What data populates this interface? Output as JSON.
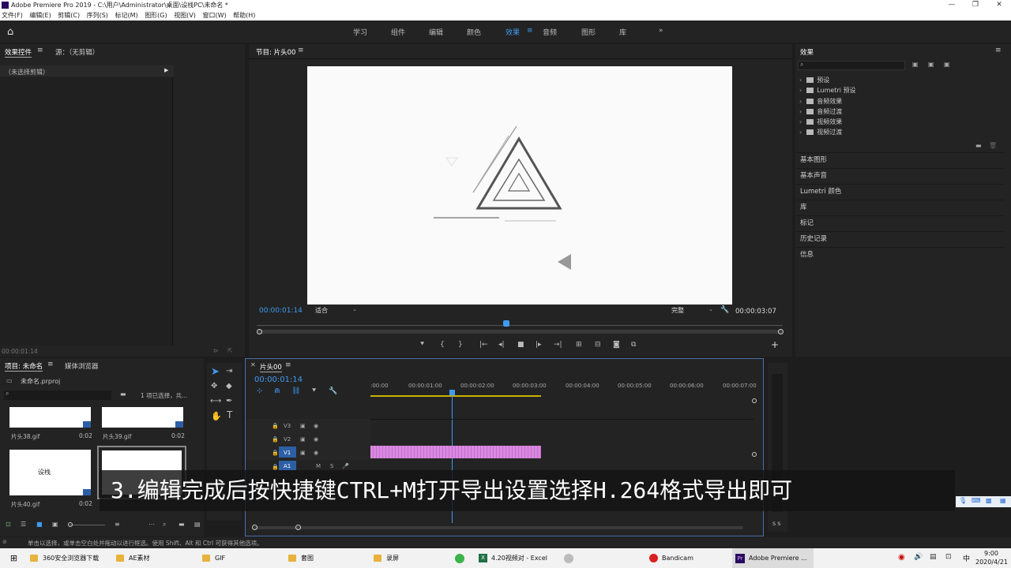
{
  "window": {
    "title": "Adobe Premiere Pro 2019 - C:\\用户\\Administrator\\桌面\\设栈PC\\未命名 *"
  },
  "menu": [
    "文件(F)",
    "编辑(E)",
    "剪辑(C)",
    "序列(S)",
    "标记(M)",
    "图形(G)",
    "视图(V)",
    "窗口(W)",
    "帮助(H)"
  ],
  "workspaces": [
    "学习",
    "组件",
    "编辑",
    "颜色",
    "效果",
    "音频",
    "图形",
    "库"
  ],
  "active_workspace": "效果",
  "effect_controls": {
    "tab_label": "效果控件",
    "source_tab": "源：（无剪辑）",
    "no_clip": "（未选择剪辑）",
    "timecode": "00:00:01:14"
  },
  "program_monitor": {
    "title": "节目: 片头00",
    "timecode_current": "00:00:01:14",
    "fit_label": "适合",
    "quality_label": "完整",
    "timecode_duration": "00:00:03:07"
  },
  "effects_panel": {
    "title": "效果",
    "items": [
      "预设",
      "Lumetri 预设",
      "音频效果",
      "音频过渡",
      "视频效果",
      "视频过渡"
    ],
    "sections": [
      "基本图形",
      "基本声音",
      "Lumetri 颜色",
      "库",
      "标记",
      "历史记录",
      "信息"
    ]
  },
  "project_panel": {
    "tab_label": "项目: 未命名",
    "media_browser_tab": "媒体浏览器",
    "file": "未命名.prproj",
    "selection": "1 项已选择，共...",
    "thumbnails": [
      {
        "name": "片头38.gif",
        "duration": "0:02"
      },
      {
        "name": "片头39.gif",
        "duration": "0:02"
      },
      {
        "name": "片头40.gif",
        "duration": "0:02"
      },
      {
        "name": "",
        "duration": ""
      }
    ],
    "thumb_logo_text": "设栈"
  },
  "timeline": {
    "tab_label": "片头00",
    "timecode": "00:00:01:14",
    "ruler": [
      ":00:00",
      "00:00:01:00",
      "00:00:02:00",
      "00:00:03:00",
      "00:00:04:00",
      "00:00:05:00",
      "00:00:06:00",
      "00:00:07:00"
    ],
    "tracks": [
      "V3",
      "V2",
      "V1",
      "A1"
    ],
    "track_buttons": [
      "M",
      "S"
    ],
    "audio_meter_label": "S S"
  },
  "status_bar": "单击以选择，或单击空白处并拖动以进行框选。使用 Shift、Alt 和 Ctrl 可获得其他选项。",
  "subtitle": "3.编辑完成后按快捷键CTRL+M打开导出设置选择H.264格式导出即可",
  "taskbar": {
    "items": [
      "360安全浏览器下载",
      "AE素材",
      "GIF",
      "套图",
      "录屏",
      "4.20视频对 - Excel",
      "Bandicam",
      "Adobe Premiere ..."
    ],
    "time": "9:00",
    "date": "2020/4/21",
    "ime": "中"
  },
  "colors": {
    "accent": "#3f9bf0",
    "clip": "#d98ae0",
    "panel": "#232323",
    "background": "#1d1d1d"
  }
}
